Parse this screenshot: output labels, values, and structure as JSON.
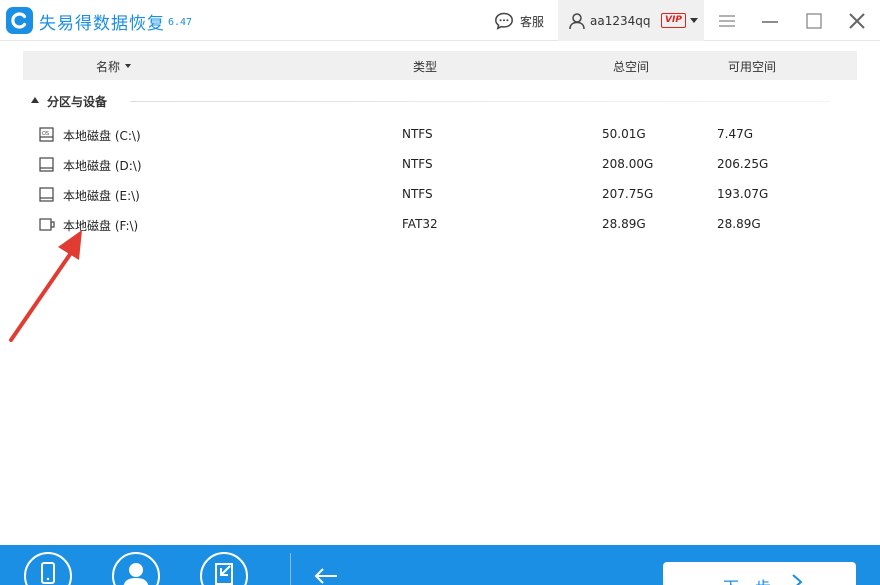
{
  "app": {
    "title": "失易得数据恢复",
    "version": "6.47",
    "brand_color": "#1a8fe3"
  },
  "titlebar": {
    "support_label": "客服",
    "username": "aa1234qq",
    "vip_badge": "VIP",
    "icons": {
      "logo": "c-logo-icon",
      "support": "chat-bubble-icon",
      "user": "user-icon",
      "menu": "hamburger-icon",
      "minimize": "minimize-icon",
      "maximize": "maximize-icon",
      "close": "close-icon"
    }
  },
  "table": {
    "columns": {
      "name": "名称",
      "type": "类型",
      "total": "总空间",
      "free": "可用空间"
    },
    "group_label": "分区与设备",
    "rows": [
      {
        "name": "本地磁盘 (C:\\)",
        "type": "NTFS",
        "total": "50.01G",
        "free": "7.47G",
        "icon": "os-drive-icon"
      },
      {
        "name": "本地磁盘 (D:\\)",
        "type": "NTFS",
        "total": "208.00G",
        "free": "206.25G",
        "icon": "hard-drive-icon"
      },
      {
        "name": "本地磁盘 (E:\\)",
        "type": "NTFS",
        "total": "207.75G",
        "free": "193.07G",
        "icon": "hard-drive-icon"
      },
      {
        "name": "本地磁盘 (F:\\)",
        "type": "FAT32",
        "total": "28.89G",
        "free": "28.89G",
        "icon": "usb-drive-icon"
      }
    ]
  },
  "annotation": {
    "arrow_color": "#e03c31"
  },
  "bottombar": {
    "next_label": "下一步",
    "icons": {
      "phone": "phone-icon",
      "user": "user-support-icon",
      "export": "export-icon",
      "back": "back-arrow-icon",
      "next": "chevron-right-icon"
    }
  }
}
